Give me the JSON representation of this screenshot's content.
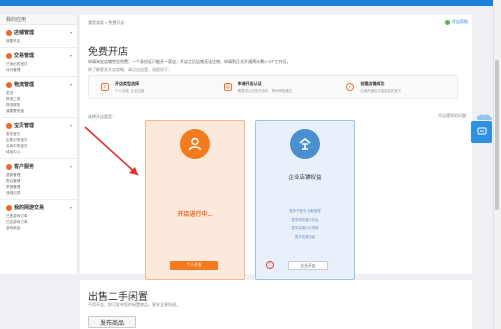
{
  "sidebar": {
    "header": "我的应用",
    "groups": [
      {
        "title": "店铺管理",
        "links": [
          "我要开店"
        ]
      },
      {
        "title": "交易管理",
        "links": [
          "已卖出的宝贝",
          "评价管理"
        ]
      },
      {
        "title": "物流管理",
        "links": [
          "发货",
          "物流工具",
          "物流服务",
          "我要寄快递"
        ]
      },
      {
        "title": "宝贝管理",
        "links": [
          "发布宝贝",
          "出售中的宝贝",
          "仓库中的宝贝",
          "体检中心"
        ]
      },
      {
        "title": "客户服务",
        "links": [
          "退款管理",
          "售后管理",
          "举报管理",
          "违规记录"
        ]
      },
      {
        "title": "我的网游交易",
        "links": [
          "已售游戏订单",
          "已买游戏订单",
          "游戏商品"
        ]
      }
    ]
  },
  "main": {
    "breadcrumb": "我是卖家 > 免费开店",
    "help": "开店帮助",
    "title": "免费开店",
    "desc1": "申请淘宝店铺完全免费；一个身份证只能开一家店；开店之后店铺无法注销，申请到正式开通预计需1~3个工作日。",
    "desc2": "除了解更多开店攻略，请点击这里，流程如下：",
    "steps": [
      {
        "title": "开店类型选择",
        "sub": "个人店铺, 企业店铺",
        "icon": "list-icon"
      },
      {
        "title": "申请开店认证",
        "sub": "需提供认证相关资料，等待审核通过",
        "icon": "document-icon"
      },
      {
        "title": "创建店铺成功",
        "sub": "店铺开通后可直接发布宝贝",
        "icon": "check-circle-icon"
      }
    ],
    "choose_label": "选择开店类型：",
    "right_note": "开店遇到的问题：",
    "card_left": {
      "status": "开店进行中...",
      "button": "个人开店"
    },
    "card_right": {
      "title": "企业店铺权益",
      "lines": [
        "更多子账号 分散管理",
        "更多简历展示机会",
        "更多高端行业资格",
        "更多权威流量"
      ],
      "button": "企业开店"
    }
  },
  "section2": {
    "title": "出售二手闲置",
    "desc": "不用开店，即可发布您的闲置物品，更安全更快速。",
    "button": "发布商品"
  },
  "colors": {
    "accent": "#f47a20",
    "blue": "#1a7fd6"
  }
}
